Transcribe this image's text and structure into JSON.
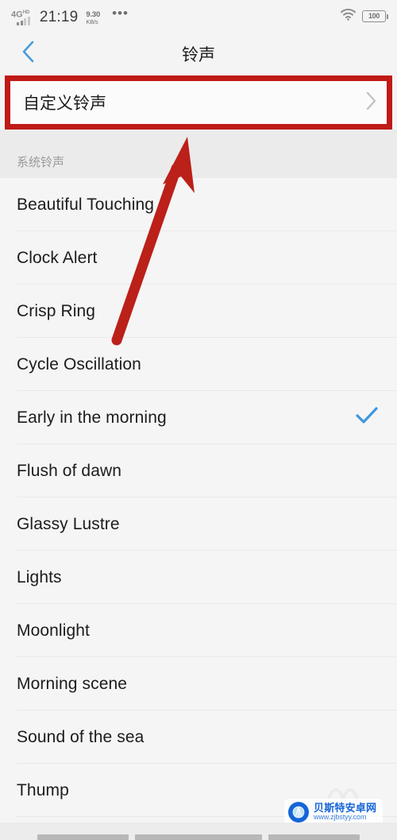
{
  "statusbar": {
    "network_type": "4G",
    "network_sup": "HD",
    "time": "21:19",
    "netspeed_value": "9.30",
    "netspeed_unit": "KB/s",
    "overflow_dots": "•••",
    "battery_level": "100",
    "wifi_icon": "wifi-icon",
    "battery_icon": "battery-icon",
    "signal_icon": "signal-bars-icon"
  },
  "titlebar": {
    "back_icon": "chevron-left-icon",
    "title": "铃声"
  },
  "custom_row": {
    "label": "自定义铃声",
    "chevron_icon": "chevron-right-icon",
    "highlight_color": "#c01a17"
  },
  "section": {
    "header": "系统铃声"
  },
  "ringtones": [
    {
      "name": "Beautiful Touching",
      "selected": false
    },
    {
      "name": "Clock Alert",
      "selected": false
    },
    {
      "name": "Crisp Ring",
      "selected": false
    },
    {
      "name": "Cycle Oscillation",
      "selected": false
    },
    {
      "name": "Early in the morning",
      "selected": true
    },
    {
      "name": "Flush of dawn",
      "selected": false
    },
    {
      "name": "Glassy Lustre",
      "selected": false
    },
    {
      "name": "Lights",
      "selected": false
    },
    {
      "name": "Moonlight",
      "selected": false
    },
    {
      "name": "Morning scene",
      "selected": false
    },
    {
      "name": "Sound of the sea",
      "selected": false
    },
    {
      "name": "Thump",
      "selected": false
    }
  ],
  "selection": {
    "check_icon": "check-mark-icon",
    "check_color": "#3d97e0"
  },
  "annotation": {
    "arrow_icon": "up-arrow-annotation",
    "arrow_color": "#bb2019"
  },
  "watermark": {
    "site_name": "贝斯特安卓网",
    "url": "www.zjbstyy.com",
    "logo_icon": "shell-logo-icon",
    "brand_color": "#1565d8"
  },
  "navbar": {
    "recents_icon": "recents-key",
    "home_icon": "home-key",
    "back_icon": "back-key"
  }
}
